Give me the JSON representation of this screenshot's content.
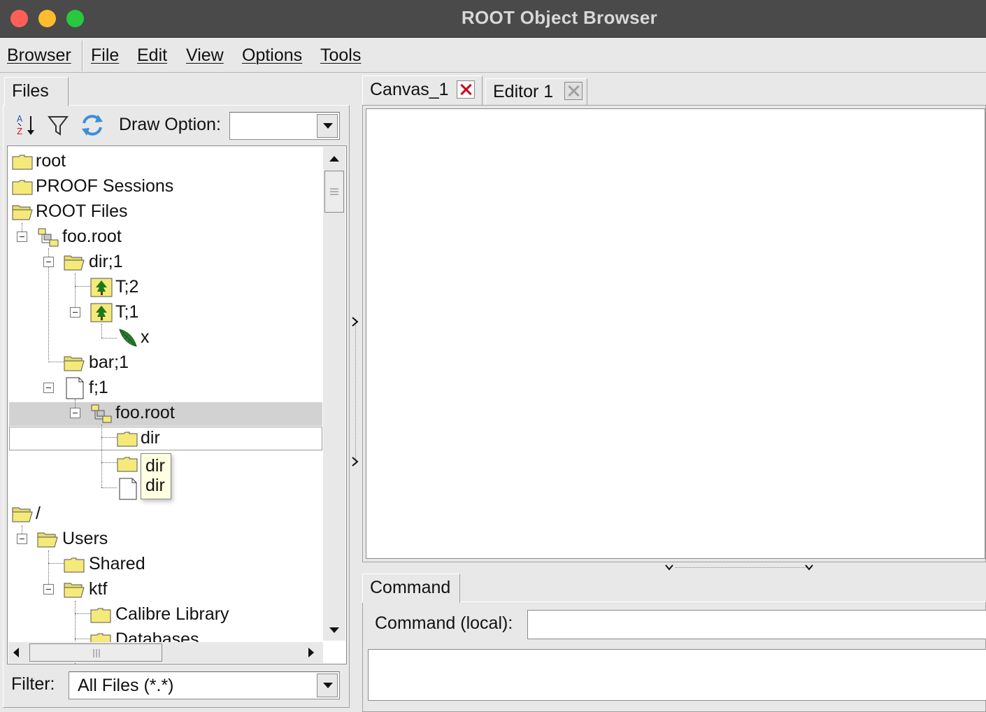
{
  "window": {
    "title": "ROOT Object Browser",
    "controls": [
      "close",
      "minimize",
      "zoom"
    ]
  },
  "menubar": {
    "items": [
      "Browser",
      "File",
      "Edit",
      "View",
      "Options",
      "Tools"
    ]
  },
  "left_panel": {
    "tab": "Files",
    "toolbar": {
      "sort_icon": "sort-az-icon",
      "filter_icon": "funnel-icon",
      "refresh_icon": "refresh-icon",
      "draw_option_label": "Draw Option:",
      "draw_option_value": ""
    },
    "tree": [
      {
        "label": "root",
        "icon": "folder-icon"
      },
      {
        "label": "PROOF Sessions",
        "icon": "folder-icon"
      },
      {
        "label": "ROOT Files",
        "icon": "open-folder-icon"
      },
      {
        "label": "foo.root",
        "icon": "root-file-icon"
      },
      {
        "label": "dir;1",
        "icon": "open-folder-icon"
      },
      {
        "label": "T;2",
        "icon": "tree-object-icon"
      },
      {
        "label": "T;1",
        "icon": "tree-object-icon"
      },
      {
        "label": "x",
        "icon": "leaf-icon"
      },
      {
        "label": "bar;1",
        "icon": "open-folder-icon"
      },
      {
        "label": "f;1",
        "icon": "document-icon"
      },
      {
        "label": "foo.root",
        "icon": "root-file-icon",
        "selected": true
      },
      {
        "label": "dir",
        "icon": "folder-icon",
        "focused": true
      },
      {
        "label": "",
        "icon": "folder-icon"
      },
      {
        "label": "",
        "icon": "document-icon"
      },
      {
        "label": "/",
        "icon": "open-folder-icon"
      },
      {
        "label": "Users",
        "icon": "open-folder-icon"
      },
      {
        "label": "Shared",
        "icon": "folder-icon"
      },
      {
        "label": "ktf",
        "icon": "open-folder-icon"
      },
      {
        "label": "Calibre Library",
        "icon": "folder-icon"
      },
      {
        "label": "Databases",
        "icon": "folder-icon"
      }
    ],
    "tooltip": [
      "dir",
      "dir"
    ],
    "filter_label": "Filter:",
    "filter_value": "All Files (*.*)"
  },
  "right_panel": {
    "tabs": [
      {
        "label": "Canvas_1",
        "active": true
      },
      {
        "label": "Editor 1",
        "active": false
      }
    ],
    "command_tab": "Command",
    "command_label": "Command (local):",
    "command_value": ""
  },
  "colors": {
    "title_bar": "#4a4a4a",
    "folder_yellow": "#f5e97a",
    "selection": "#d2d2d2",
    "close_red": "#d0021b",
    "tooltip_bg": "#ffffe1"
  }
}
